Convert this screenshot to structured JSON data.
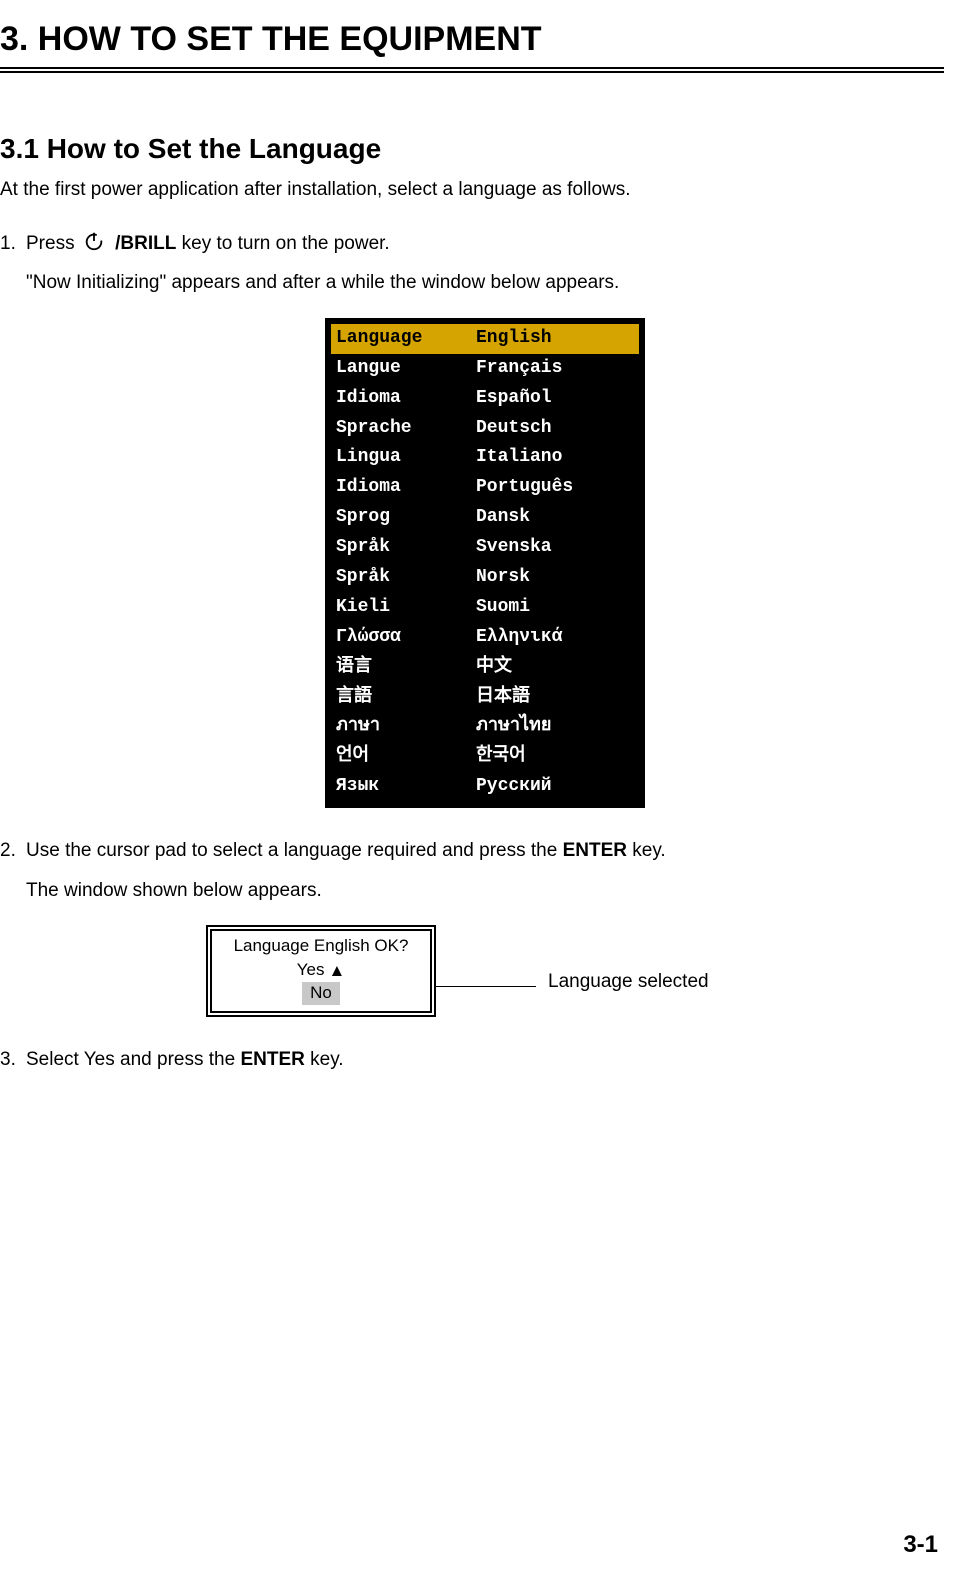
{
  "chapter_title": "3.    HOW TO SET THE EQUIPMENT",
  "section_title": "3.1    How to Set the Language",
  "intro": "At the first power application after installation, select a language as follows.",
  "step1": {
    "press": "Press",
    "brill": "/BRILL",
    "after": " key to turn on the power.",
    "note": "\"Now Initializing\" appears and after a while the window below appears."
  },
  "language_menu": [
    {
      "label": "Language",
      "value": "English",
      "highlight": true
    },
    {
      "label": "Langue",
      "value": "Français",
      "highlight": false
    },
    {
      "label": "Idioma",
      "value": "Español",
      "highlight": false
    },
    {
      "label": "Sprache",
      "value": "Deutsch",
      "highlight": false
    },
    {
      "label": "Lingua",
      "value": "Italiano",
      "highlight": false
    },
    {
      "label": "Idioma",
      "value": "Português",
      "highlight": false
    },
    {
      "label": "Sprog",
      "value": "Dansk",
      "highlight": false
    },
    {
      "label": "Språk",
      "value": "Svenska",
      "highlight": false
    },
    {
      "label": "Språk",
      "value": "Norsk",
      "highlight": false
    },
    {
      "label": "Kieli",
      "value": "Suomi",
      "highlight": false
    },
    {
      "label": "Γλώσσα",
      "value": "Ελληνικά",
      "highlight": false
    },
    {
      "label": "语言",
      "value": "中文",
      "highlight": false
    },
    {
      "label": "言語",
      "value": "日本語",
      "highlight": false
    },
    {
      "label": "ภาษา",
      "value": "ภาษาไทย",
      "highlight": false
    },
    {
      "label": "언어",
      "value": "한국어",
      "highlight": false
    },
    {
      "label": "Язык",
      "value": "Русский",
      "highlight": false
    }
  ],
  "step2": {
    "text_pre": "Use the cursor pad to select a language required and press the ",
    "enter": "ENTER",
    "text_post": " key.",
    "note": "The window shown below appears."
  },
  "confirm": {
    "question": "Language English OK?",
    "yes": "Yes",
    "no": "No",
    "annotation": "Language selected"
  },
  "step3": {
    "text_pre": "Select Yes and press the ",
    "enter": "ENTER",
    "text_post": " key."
  },
  "page_number": "3-1"
}
